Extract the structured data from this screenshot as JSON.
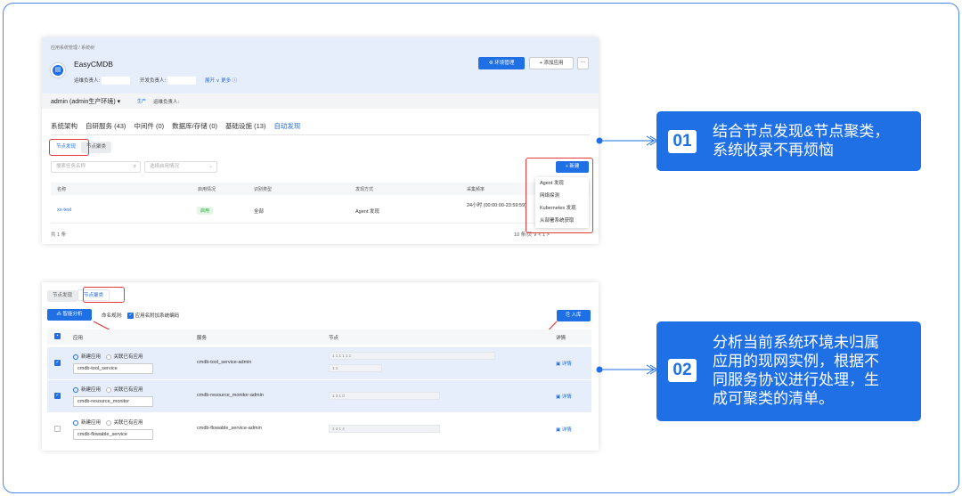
{
  "panel1": {
    "breadcrumb": "应用系统管理 / 系统树",
    "app_name": "EasyCMDB",
    "ops_owner_label": "运维负责人:",
    "dev_owner_label": "开发负责人:",
    "expand_label": "展开 ∨ 更多 ⓘ",
    "env_button": "环境管理",
    "add_app_button": "+ 添加应用",
    "more_button": "···",
    "env_selector": "admin (admin生产环境) ▾",
    "env_tag": "生产",
    "env_ops_owner": "运维负责人:",
    "tabs": [
      "系统架构",
      "自研服务 (43)",
      "中间件 (0)",
      "数据库/存储 (0)",
      "基础设施 (13)",
      "自动发现"
    ],
    "subtabs": [
      "节点发现",
      "节点聚类"
    ],
    "search_placeholder": "搜索任务名称",
    "filter_placeholder": "选择启用情况",
    "new_button": "+ 新建",
    "columns": [
      "名称",
      "启用情况",
      "识别类型",
      "发现方式",
      "采集频率"
    ],
    "row": {
      "name": "xx-test",
      "status": "启用",
      "type": "全部",
      "method": "Agent 发现",
      "freq": "24小时 (00:00:00-23:59:59)"
    },
    "total": "共 1 条",
    "pager": "10 条/页 ∨   <   1   >",
    "dropdown": [
      "Agent 发现",
      "网络探测",
      "Kubernetes 发现",
      "从部署系统获取"
    ]
  },
  "panel2": {
    "subtabs": [
      "节点发现",
      "节点聚类"
    ],
    "smart_button": "智能分析",
    "naming_label": "命名规则:",
    "naming_checkbox": "应用名附加系统编码",
    "import_button": "入库",
    "columns": [
      "应用",
      "服务",
      "节点",
      "详情"
    ],
    "radio_new": "新建应用",
    "radio_link": "关联已有应用",
    "detail_label": "详情",
    "rows": [
      {
        "checked": true,
        "app": "cmdb-tool_service",
        "service": "cmdb-tool_service-admin",
        "nodes1": "1          1    1          1    1          1",
        "nodes2": "1          1"
      },
      {
        "checked": true,
        "app": "cmdb-resource_monitor",
        "service": "cmdb-resource_monitor-admin",
        "nodes1": "1          3    1          0",
        "nodes2": ""
      },
      {
        "checked": false,
        "app": "cmdb-flowable_service",
        "service": "cmdb-flowable_service-admin",
        "nodes1": "1          4    1          4",
        "nodes2": ""
      }
    ]
  },
  "callouts": [
    {
      "num": "01",
      "text": "结合节点发现&节点聚类，\n系统收录不再烦恼"
    },
    {
      "num": "02",
      "text": "分析当前系统环境未归属\n应用的现网实例，根据不\n同服务协议进行处理，生\n成可聚类的清单。"
    }
  ],
  "colors": {
    "accent": "#1f6fe5",
    "highlight": "#e23a3a",
    "frame": "#4a86f0"
  }
}
